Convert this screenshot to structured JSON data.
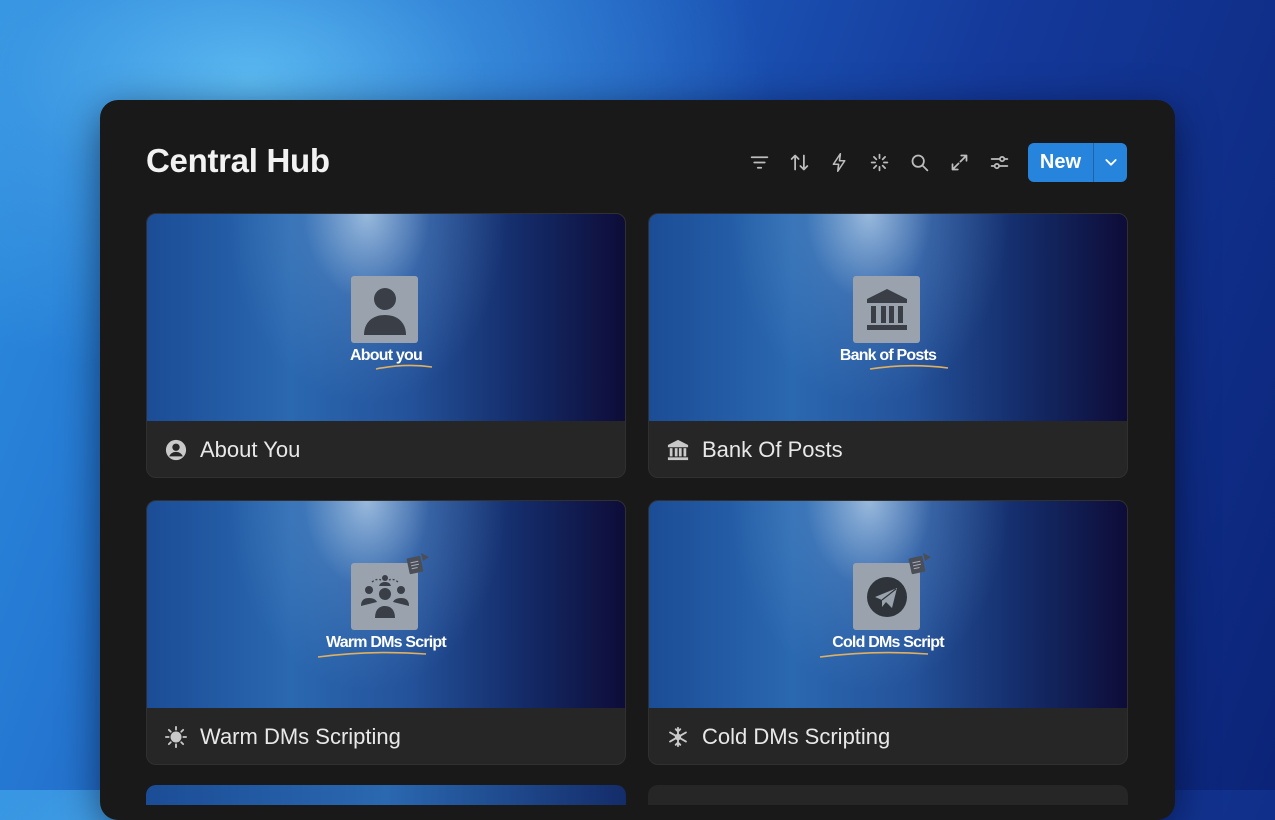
{
  "page": {
    "title": "Central Hub",
    "accent_color": "#2784dc"
  },
  "toolbar": {
    "tools": [
      {
        "icon": "filter-icon"
      },
      {
        "icon": "sort-icon"
      },
      {
        "icon": "lightning-icon"
      },
      {
        "icon": "sparkle-icon"
      },
      {
        "icon": "search-icon"
      },
      {
        "icon": "expand-icon"
      },
      {
        "icon": "settings-sliders-icon"
      }
    ],
    "new_label": "New",
    "new_dropdown_icon": "chevron-down-icon"
  },
  "cards": [
    {
      "label": "About You",
      "icon": "user-circle-icon",
      "cover_text": "About you",
      "cover_icon": "person-icon"
    },
    {
      "label": "Bank Of Posts",
      "icon": "bank-icon",
      "cover_text": "Bank of Posts",
      "cover_icon": "bank-icon"
    },
    {
      "label": "Warm DMs Scripting",
      "icon": "sun-icon",
      "cover_text": "Warm DMs Script",
      "cover_icon": "group-icon"
    },
    {
      "label": "Cold DMs Scripting",
      "icon": "snowflake-icon",
      "cover_text": "Cold DMs Script",
      "cover_icon": "paper-plane-icon"
    }
  ]
}
